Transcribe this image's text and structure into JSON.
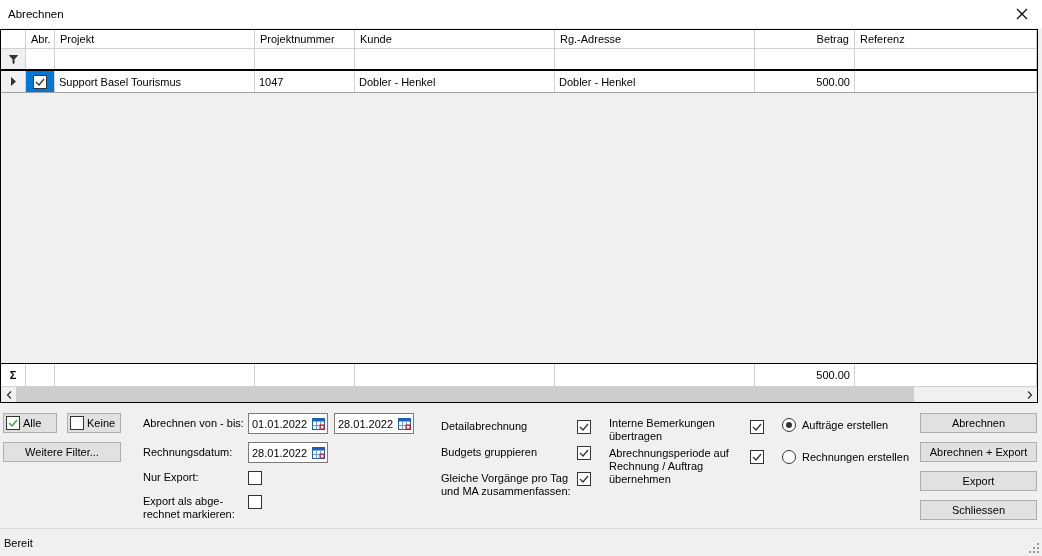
{
  "window": {
    "title": "Abrechnen"
  },
  "table": {
    "columns": [
      {
        "label": "Abr.",
        "kind": "checkbox"
      },
      {
        "label": "Projekt",
        "kind": "text"
      },
      {
        "label": "Projektnummer",
        "kind": "text"
      },
      {
        "label": "Kunde",
        "kind": "text"
      },
      {
        "label": "Rg.-Adresse",
        "kind": "text"
      },
      {
        "label": "Betrag",
        "kind": "amount"
      },
      {
        "label": "Referenz",
        "kind": "text"
      }
    ],
    "rows": [
      {
        "current": true,
        "checked": true,
        "selected": true,
        "cells": [
          "",
          "Support Basel Tourismus",
          "1047",
          "Dobler - Henkel",
          "Dobler - Henkel",
          "500.00",
          ""
        ]
      }
    ],
    "sum_row": {
      "symbol": "Σ",
      "cells": [
        "",
        "",
        "",
        "",
        "",
        "500.00",
        ""
      ]
    }
  },
  "selection": [
    {
      "label": "Alle",
      "checked": true
    },
    {
      "label": "Keine",
      "checked": false
    }
  ],
  "filter_button": "Weitere Filter...",
  "dates": [
    {
      "label": "Abrechnen von - bis:",
      "values": [
        "01.01.2022",
        "28.01.2022"
      ]
    },
    {
      "label": "Rechnungsdatum:",
      "values": [
        "28.01.2022"
      ]
    }
  ],
  "export_options": [
    {
      "label": "Nur Export:",
      "checked": false
    },
    {
      "label": "Export als abge-\nrechnet markieren:",
      "checked": false
    }
  ],
  "options_1": [
    {
      "label": "Detailabrechnung",
      "checked": true
    },
    {
      "label": "Budgets gruppieren",
      "checked": true
    },
    {
      "label": "Gleiche Vorgänge pro Tag\nund MA zusammenfassen:",
      "checked": true
    }
  ],
  "options_2": [
    {
      "label": "Interne Bemerkungen\nübertragen",
      "checked": true
    },
    {
      "label": "Abrechnungsperiode auf\nRechnung / Auftrag\nübernehmen",
      "checked": true
    }
  ],
  "mode": [
    {
      "label": "Aufträge erstellen",
      "selected": true
    },
    {
      "label": "Rechnungen erstellen",
      "selected": false
    }
  ],
  "buttons": [
    "Abrechnen",
    "Abrechnen + Export",
    "Export",
    "Schliessen"
  ],
  "status_bar": "Bereit"
}
